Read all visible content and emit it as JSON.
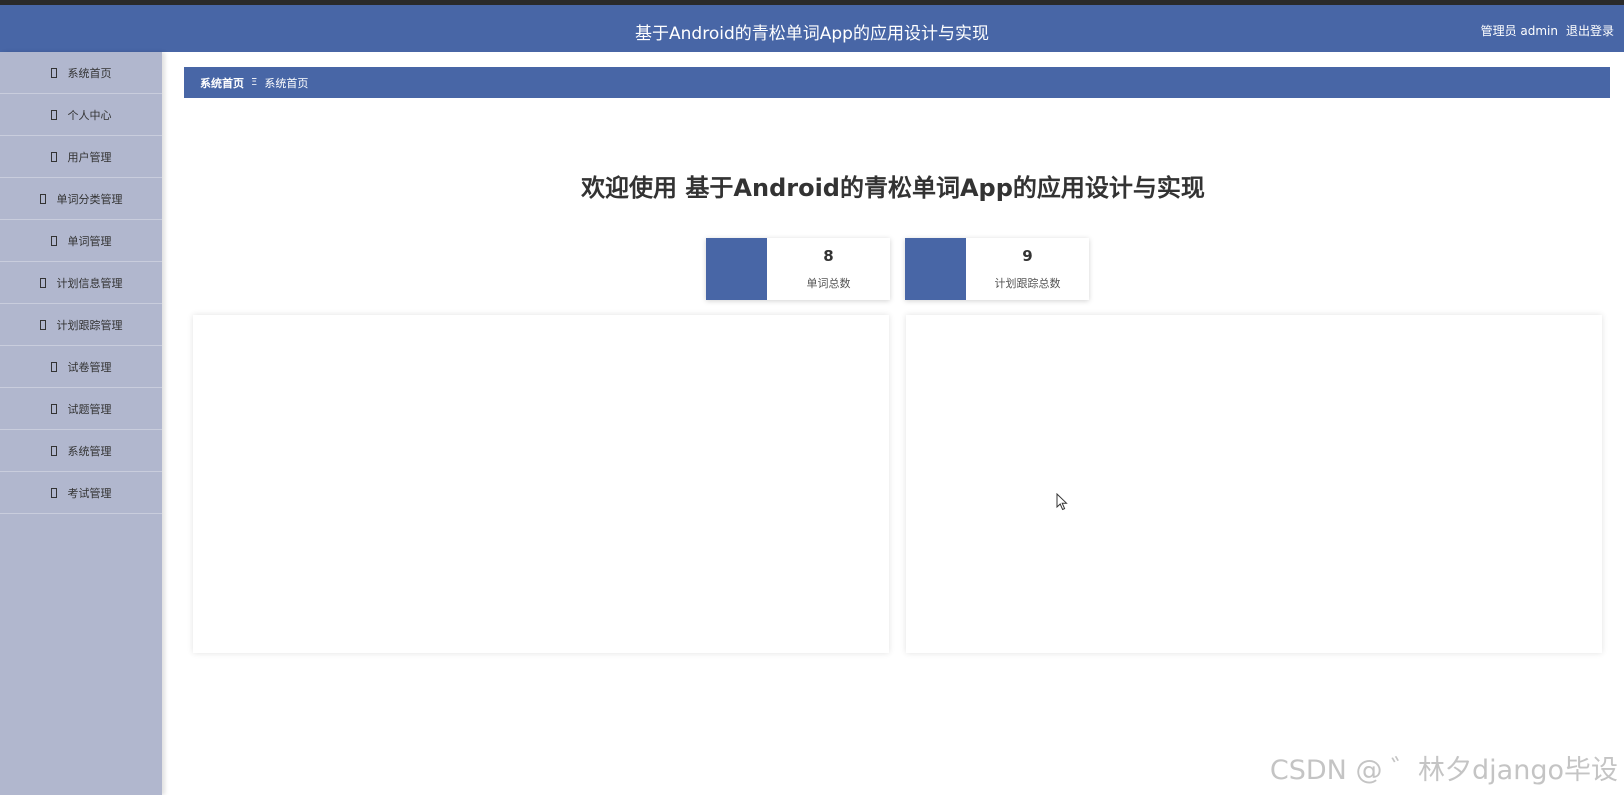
{
  "header": {
    "title": "基于Android的青松单词App的应用设计与实现",
    "role": "管理员 admin",
    "logout_label": "退出登录"
  },
  "sidebar": {
    "items": [
      {
        "label": "系统首页"
      },
      {
        "label": "个人中心"
      },
      {
        "label": "用户管理"
      },
      {
        "label": "单词分类管理"
      },
      {
        "label": "单词管理"
      },
      {
        "label": "计划信息管理"
      },
      {
        "label": "计划跟踪管理"
      },
      {
        "label": "试卷管理"
      },
      {
        "label": "试题管理"
      },
      {
        "label": "系统管理"
      },
      {
        "label": "考试管理"
      }
    ]
  },
  "breadcrumb": {
    "home": "系统首页",
    "separator": "Ξ",
    "current": "系统首页"
  },
  "main": {
    "welcome": "欢迎使用 基于Android的青松单词App的应用设计与实现",
    "stats": [
      {
        "value": "8",
        "label": "单词总数"
      },
      {
        "value": "9",
        "label": "计划跟踪总数"
      }
    ]
  },
  "watermark": "CSDN @ ゛林夕django毕设",
  "colors": {
    "accent": "#4866a6",
    "sidebar_bg": "#b1b7ce"
  }
}
